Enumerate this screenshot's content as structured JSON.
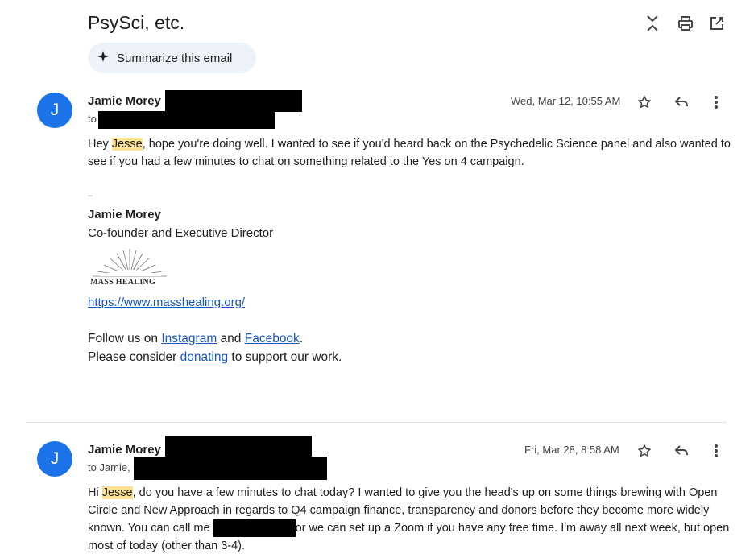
{
  "subject": "PsySci, etc.",
  "summarize_label": "Summarize this email",
  "messages": [
    {
      "avatar_letter": "J",
      "sender": "Jamie Morey",
      "to_prefix": "to",
      "date": "Wed, Mar 12, 10:55 AM",
      "body": {
        "greeting": "Hey ",
        "name": "Jesse",
        "line1_rest": ", hope you're doing well. I wanted to see if you'd heard back on the Psychedelic Science panel and also wanted to",
        "line2": "see if you had a few minutes to chat on something related to the Yes on 4 campaign."
      },
      "signature": {
        "separator": "--",
        "name": "Jamie Morey",
        "title": "Co-founder and Executive Director",
        "logo_text": "MASS HEALING",
        "website": "https://www.masshealing.org/",
        "follow_prefix": "Follow us on ",
        "instagram": "Instagram",
        "and": " and ",
        "facebook": "Facebook",
        "period": ".",
        "consider_prefix": "Please consider ",
        "donating": "donating",
        "consider_suffix": " to support our work."
      }
    },
    {
      "avatar_letter": "J",
      "sender": "Jamie Morey",
      "to_prefix": "to Jamie,",
      "date": "Fri, Mar 28, 8:58 AM",
      "body": {
        "greeting": "Hi ",
        "name": "Jesse",
        "line1_rest": ", do you have a few minutes to chat today? I wanted to give you the head's up on some things brewing with Open",
        "line2": "Circle and New Approach in regards to Q4 campaign finance, transparency and donors before they become more widely",
        "line3_pre": "known. You can call me ",
        "line3_post": "or we can set up a Zoom if you have any free time. I'm away all next week, but open",
        "line4": "most of today (other than 3-4)."
      }
    }
  ],
  "colors": {
    "avatar": "#1a73e8",
    "highlight": "#fde293",
    "link": "#1a55c8",
    "summarize_bg": "#eef2f9"
  },
  "icons": [
    "collapse-all-icon",
    "print-icon",
    "open-in-new-window-icon",
    "sparkle-icon",
    "star-icon",
    "reply-icon",
    "more-vert-icon"
  ]
}
